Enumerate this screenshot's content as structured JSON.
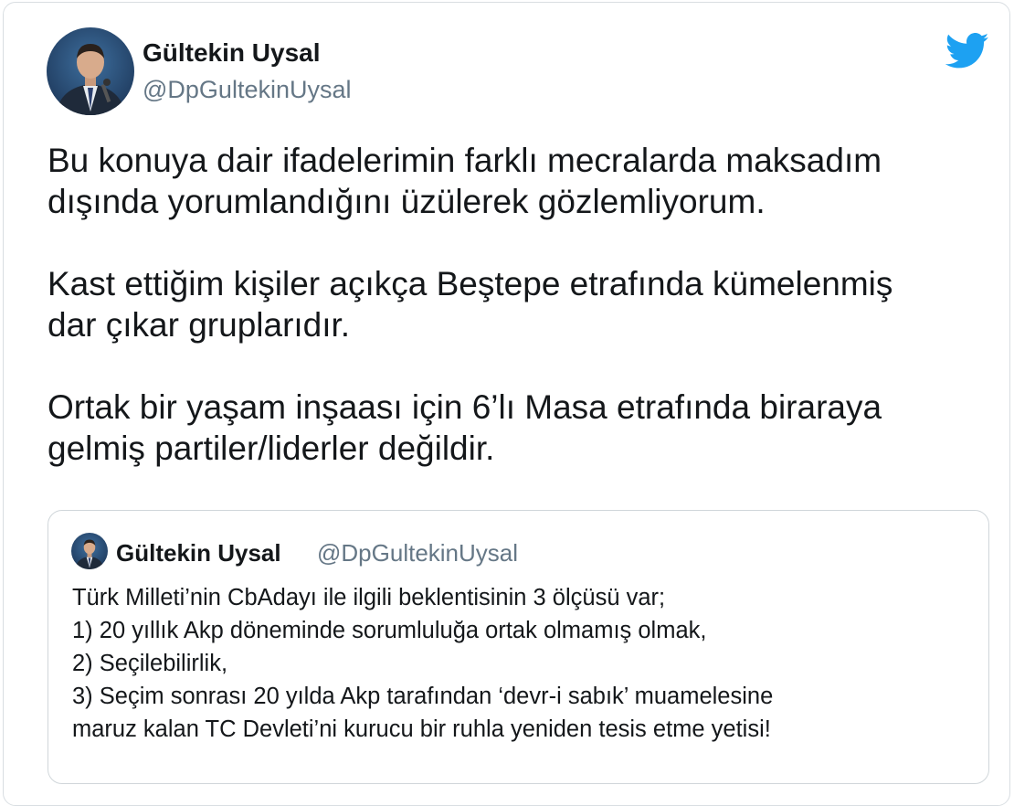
{
  "tweet": {
    "author": {
      "name": "Gültekin Uysal",
      "handle": "@DpGultekinUysal"
    },
    "icon": "twitter-bird-icon",
    "brand_color": "#1da1f2",
    "paragraphs": [
      "Bu konuya dair ifadelerimin farklı mecralarda maksadım\ndışında yorumlandığını üzülerek gözlemliyorum.",
      "Kast ettiğim kişiler açıkça Beştepe etrafında kümelenmiş\ndar çıkar gruplarıdır.",
      "Ortak bir yaşam inşaası için 6’lı Masa etrafında biraraya\ngelmiş partiler/liderler değildir."
    ]
  },
  "quoted_tweet": {
    "author": {
      "name": "Gültekin Uysal",
      "handle": "@DpGultekinUysal"
    },
    "lines": [
      "Türk Milleti’nin CbAdayı ile ilgili beklentisinin 3 ölçüsü var;",
      "1) 20 yıllık Akp döneminde sorumluluğa ortak olmamış olmak,",
      "2) Seçilebilirlik,",
      "3) Seçim sonrası 20 yılda Akp tarafından ‘devr-i sabık’ muamelesine",
      "maruz kalan TC Devleti’ni kurucu bir ruhla yeniden tesis etme yetisi!"
    ]
  }
}
